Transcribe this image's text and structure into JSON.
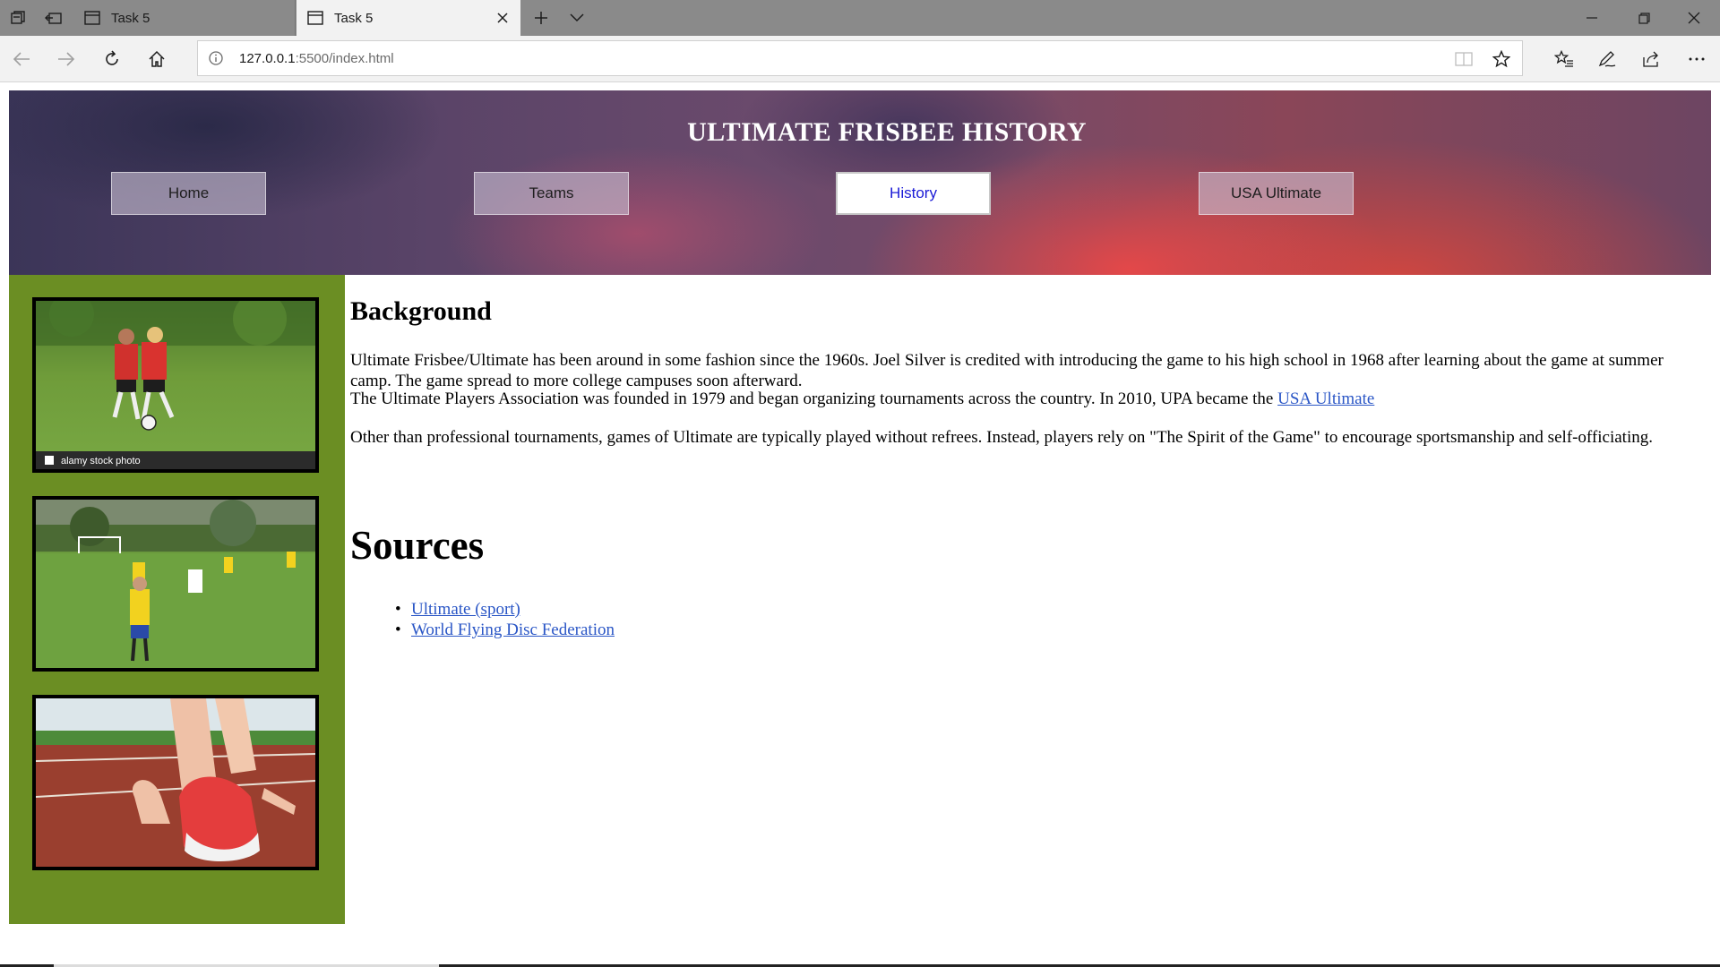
{
  "browser": {
    "tabs": [
      {
        "title": "Task 5"
      },
      {
        "title": "Task 5"
      }
    ],
    "address": {
      "host": "127.0.0.1",
      "path": ":5500/index.html"
    }
  },
  "header": {
    "title": "ULTIMATE FRISBEE HISTORY",
    "nav": [
      {
        "label": "Home"
      },
      {
        "label": "Teams"
      },
      {
        "label": "History"
      },
      {
        "label": "USA Ultimate"
      }
    ],
    "active_nav": "History"
  },
  "sidebar": {
    "images": [
      {
        "caption": "alamy stock photo"
      },
      {
        "caption": ""
      },
      {
        "caption": ""
      }
    ]
  },
  "content": {
    "heading": "Background",
    "paragraphs": [
      "Ultimate Frisbee/Ultimate has been around in some fashion since the 1960s. Joel Silver is credited with introducing the game to his high school in 1968 after learning about the game at summer camp. The game spread to more college campuses soon afterward.",
      "The Ultimate Players Association was founded in 1979 and began organizing tournaments across the country. In 2010, UPA became the ",
      "Other than professional tournaments, games of Ultimate are typically played without refrees. Instead, players rely on \"The Spirit of the Game\" to encourage sportsmanship and self-officiating."
    ],
    "inline_link": "USA Ultimate",
    "sources_heading": "Sources",
    "sources": [
      {
        "label": "Ultimate (sport)"
      },
      {
        "label": "World Flying Disc Federation"
      }
    ]
  },
  "colors": {
    "sidebar": "#6b8e23",
    "link": "#2a56c6",
    "active_nav_text": "#1a1ad6"
  }
}
